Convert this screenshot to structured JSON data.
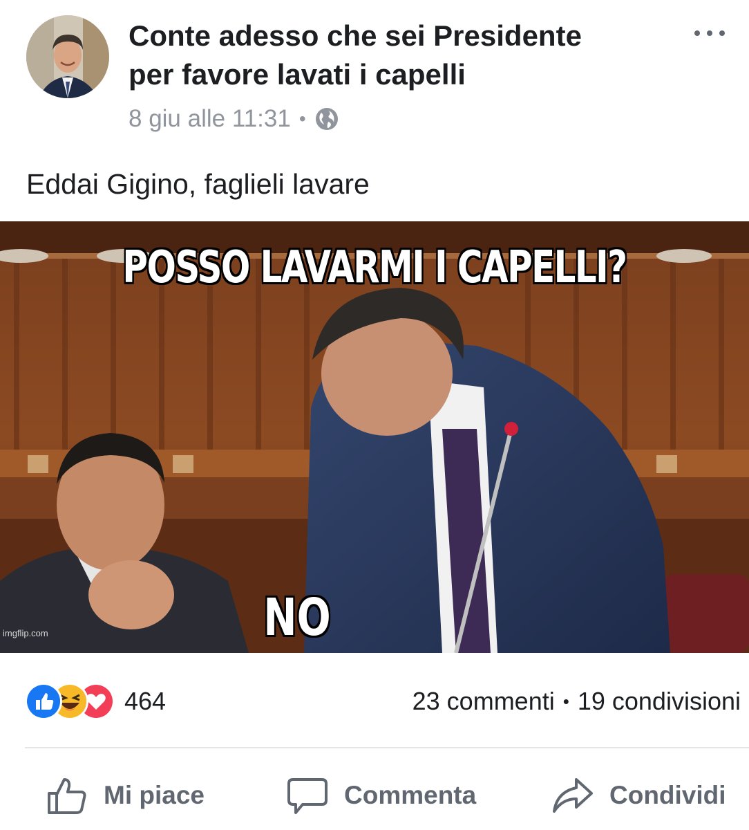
{
  "post": {
    "page_name_line1": "Conte adesso che sei Presidente",
    "page_name_line2": "per favore lavati i capelli",
    "date": "8 giu alle 11:31",
    "separator": "•",
    "privacy_icon": "globe-icon",
    "more_icon": "more-options-icon",
    "text": "Eddai Gigino, faglieli lavare"
  },
  "meme": {
    "caption_top": "POSSO LAVARMI I CAPELLI?",
    "caption_bottom": "NO",
    "watermark": "imgflip.com"
  },
  "engagement": {
    "reaction_icons": [
      "like-reaction-icon",
      "haha-reaction-icon",
      "love-reaction-icon"
    ],
    "reaction_count": "464",
    "comments": "23 commenti",
    "separator": "•",
    "shares": "19 condivisioni"
  },
  "actions": {
    "like_label": "Mi piace",
    "comment_label": "Commenta",
    "share_label": "Condividi"
  },
  "colors": {
    "text": "#1c1e21",
    "meta": "#90949c",
    "action": "#606770",
    "like_blue": "#1877f2",
    "love_red": "#f33e58",
    "haha_yellow": "#f7b928",
    "divider": "#e5e6e9"
  }
}
